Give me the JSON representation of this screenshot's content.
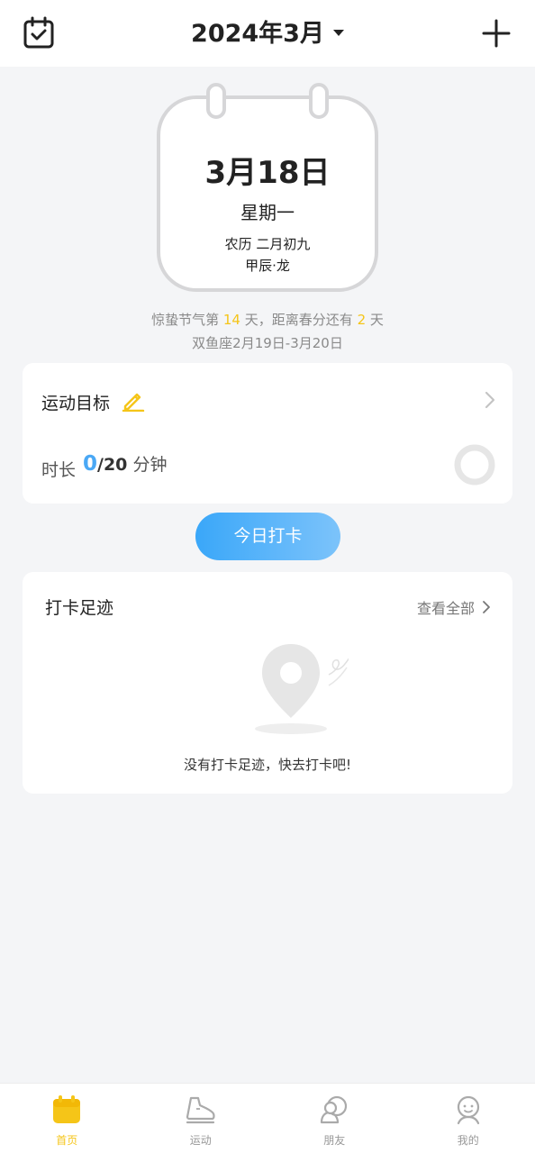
{
  "header": {
    "title": "2024年3月",
    "left_icon": "calendar-check-icon",
    "right_icon": "plus-icon"
  },
  "calendar": {
    "date": "3月18日",
    "weekday": "星期一",
    "lunar": "农历 二月初九",
    "ganzhi": "甲辰·龙"
  },
  "info": {
    "solar_term_prefix": "惊蛰节气第",
    "solar_term_days": "14",
    "solar_term_mid": "天，距离春分还有",
    "next_term_days": "2",
    "solar_term_suffix": "天",
    "zodiac": "双鱼座2月19日-3月20日"
  },
  "goal": {
    "title": "运动目标",
    "duration_label": "时长",
    "current": "0",
    "target": "/20",
    "unit": "分钟",
    "progress": 0
  },
  "checkin": {
    "button_label": "今日打卡"
  },
  "footprint": {
    "title": "打卡足迹",
    "view_all": "查看全部",
    "empty_text": "没有打卡足迹，快去打卡吧!"
  },
  "nav": {
    "items": [
      {
        "label": "首页",
        "icon": "calendar-icon",
        "active": true
      },
      {
        "label": "运动",
        "icon": "sneaker-icon",
        "active": false
      },
      {
        "label": "朋友",
        "icon": "friends-icon",
        "active": false
      },
      {
        "label": "我的",
        "icon": "profile-icon",
        "active": false
      }
    ]
  },
  "colors": {
    "accent_yellow": "#f5c518",
    "accent_blue": "#4aa8f5",
    "background": "#f4f5f7"
  }
}
